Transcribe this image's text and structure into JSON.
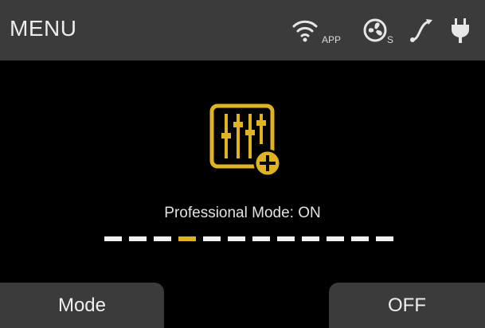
{
  "header": {
    "title": "MENU",
    "app_label": "APP",
    "fan_label": "S",
    "icons": [
      "wifi-icon",
      "fan-icon",
      "curve-icon",
      "plug-icon"
    ]
  },
  "main": {
    "icon": "equalizer-plus-icon",
    "mode_label": "Professional Mode:",
    "mode_value": "ON",
    "selected_level": 4,
    "total_levels": 12
  },
  "softkeys": {
    "left": "Mode",
    "right": "OFF"
  },
  "colors": {
    "accent": "#e0b322",
    "bar": "#3b3b3b",
    "background": "#000000"
  }
}
